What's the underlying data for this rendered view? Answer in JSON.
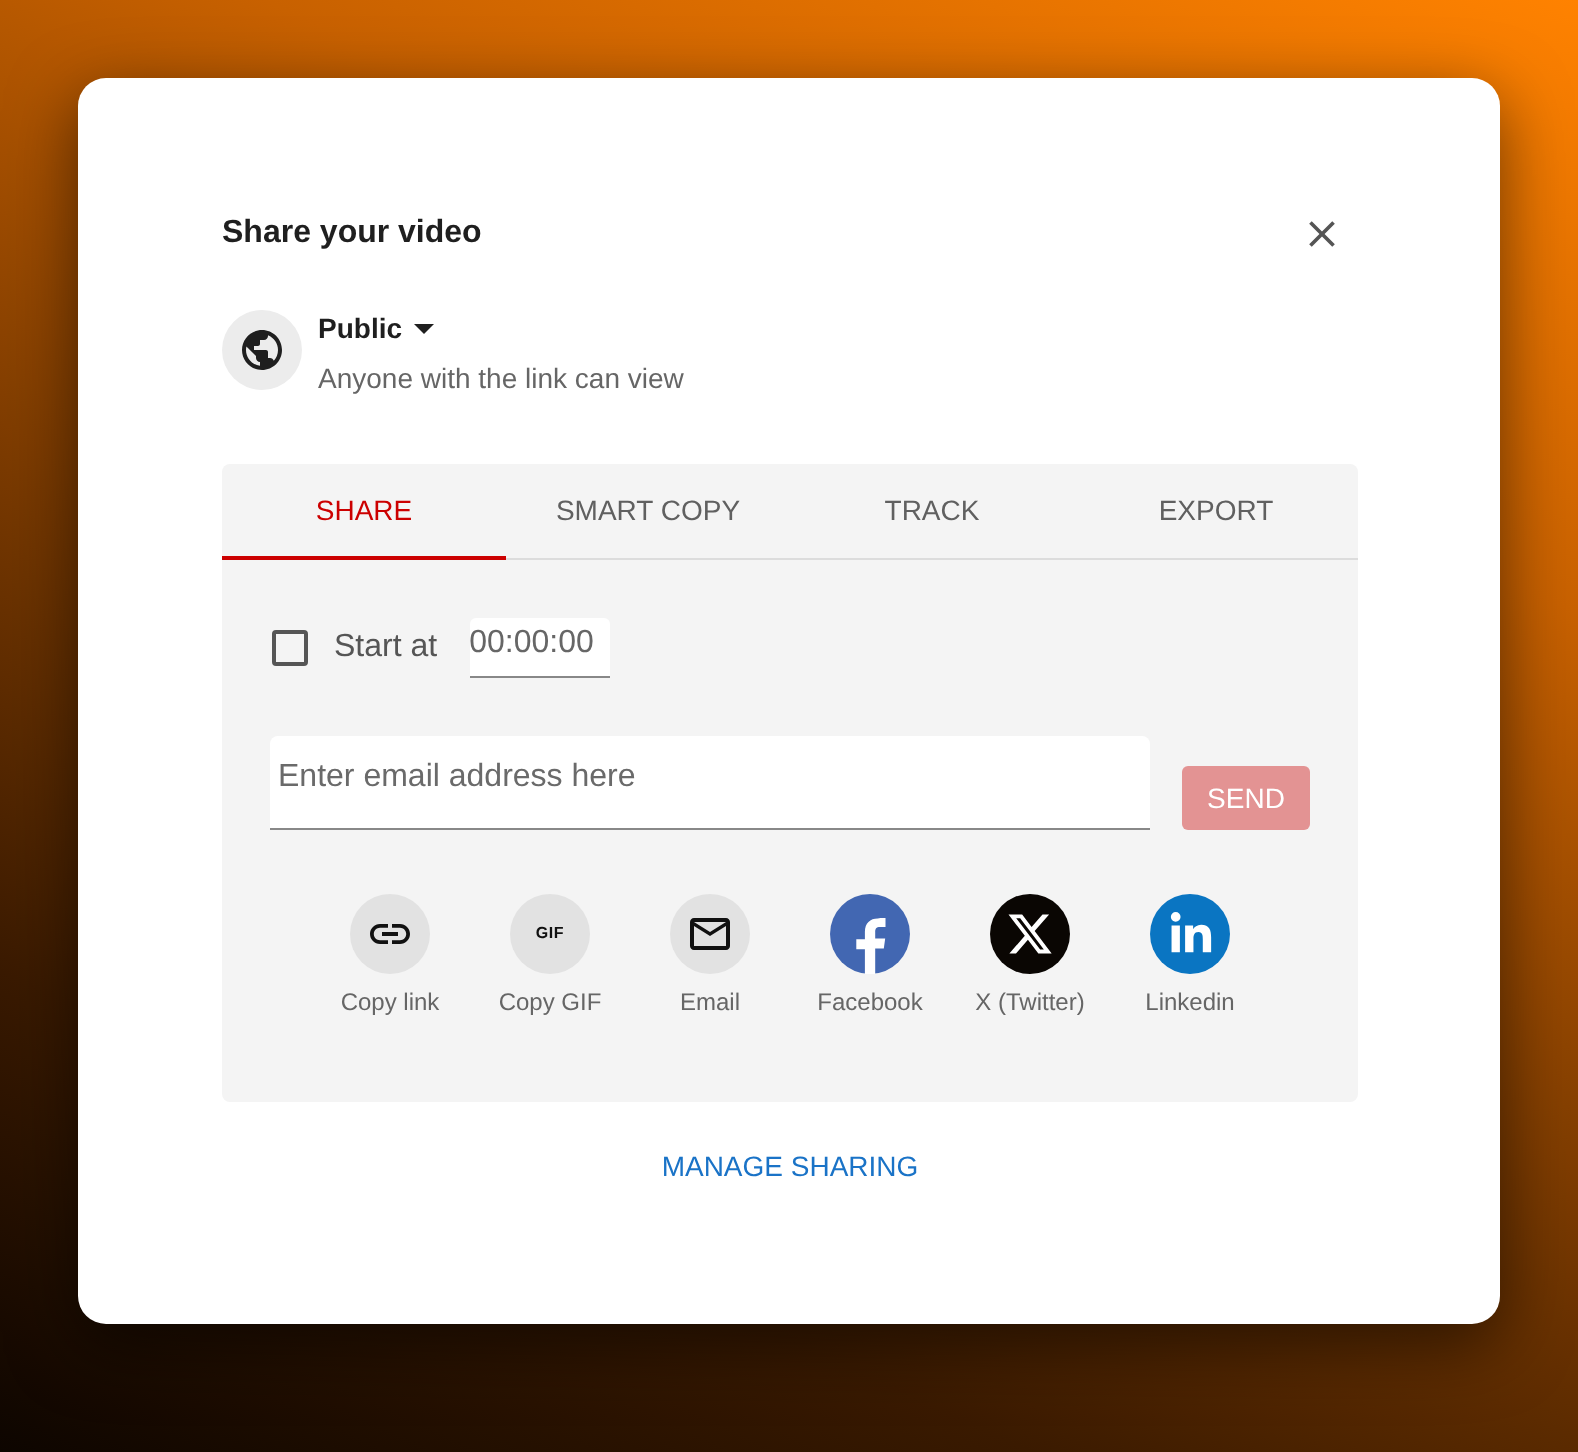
{
  "dialog": {
    "title": "Share your video"
  },
  "visibility": {
    "label": "Public",
    "description": "Anyone with the link can view"
  },
  "tabs": [
    {
      "label": "SHARE",
      "selected": true
    },
    {
      "label": "SMART COPY",
      "selected": false
    },
    {
      "label": "TRACK",
      "selected": false
    },
    {
      "label": "EXPORT",
      "selected": false
    }
  ],
  "start_at": {
    "label": "Start at",
    "checked": false,
    "value": "00:00:00"
  },
  "email": {
    "placeholder": "Enter email address here",
    "button": "SEND",
    "disabled": true
  },
  "share_targets": [
    {
      "kind": "link",
      "label": "Copy link"
    },
    {
      "kind": "gif",
      "label": "Copy GIF",
      "icon_text": "GIF"
    },
    {
      "kind": "email",
      "label": "Email"
    },
    {
      "kind": "facebook",
      "label": "Facebook"
    },
    {
      "kind": "x",
      "label": "X (Twitter)"
    },
    {
      "kind": "linkedin",
      "label": "Linkedin"
    }
  ],
  "manage_link": "MANAGE SHARING"
}
